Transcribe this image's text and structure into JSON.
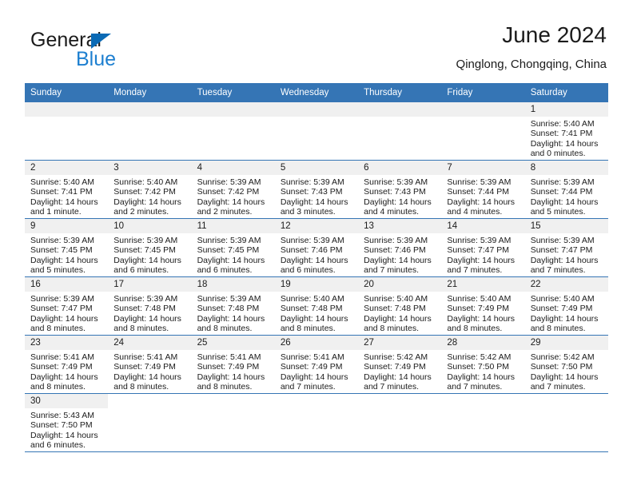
{
  "brand": {
    "name_top": "General",
    "name_bottom": "Blue",
    "accent_color": "#1d7fd0",
    "triangle_color": "#0a6ab5"
  },
  "header": {
    "title": "June 2024",
    "subtitle": "Qinglong, Chongqing, China"
  },
  "calendar": {
    "header_bg": "#3575b5",
    "daynum_bg": "#f0f0f0",
    "weekdays": [
      "Sunday",
      "Monday",
      "Tuesday",
      "Wednesday",
      "Thursday",
      "Friday",
      "Saturday"
    ],
    "weeks": [
      [
        {
          "day": "",
          "sunrise": "",
          "sunset": "",
          "daylight1": "",
          "daylight2": "",
          "empty": true
        },
        {
          "day": "",
          "sunrise": "",
          "sunset": "",
          "daylight1": "",
          "daylight2": "",
          "empty": true
        },
        {
          "day": "",
          "sunrise": "",
          "sunset": "",
          "daylight1": "",
          "daylight2": "",
          "empty": true
        },
        {
          "day": "",
          "sunrise": "",
          "sunset": "",
          "daylight1": "",
          "daylight2": "",
          "empty": true
        },
        {
          "day": "",
          "sunrise": "",
          "sunset": "",
          "daylight1": "",
          "daylight2": "",
          "empty": true
        },
        {
          "day": "",
          "sunrise": "",
          "sunset": "",
          "daylight1": "",
          "daylight2": "",
          "empty": true
        },
        {
          "day": "1",
          "sunrise": "Sunrise: 5:40 AM",
          "sunset": "Sunset: 7:41 PM",
          "daylight1": "Daylight: 14 hours",
          "daylight2": "and 0 minutes."
        }
      ],
      [
        {
          "day": "2",
          "sunrise": "Sunrise: 5:40 AM",
          "sunset": "Sunset: 7:41 PM",
          "daylight1": "Daylight: 14 hours",
          "daylight2": "and 1 minute."
        },
        {
          "day": "3",
          "sunrise": "Sunrise: 5:40 AM",
          "sunset": "Sunset: 7:42 PM",
          "daylight1": "Daylight: 14 hours",
          "daylight2": "and 2 minutes."
        },
        {
          "day": "4",
          "sunrise": "Sunrise: 5:39 AM",
          "sunset": "Sunset: 7:42 PM",
          "daylight1": "Daylight: 14 hours",
          "daylight2": "and 2 minutes."
        },
        {
          "day": "5",
          "sunrise": "Sunrise: 5:39 AM",
          "sunset": "Sunset: 7:43 PM",
          "daylight1": "Daylight: 14 hours",
          "daylight2": "and 3 minutes."
        },
        {
          "day": "6",
          "sunrise": "Sunrise: 5:39 AM",
          "sunset": "Sunset: 7:43 PM",
          "daylight1": "Daylight: 14 hours",
          "daylight2": "and 4 minutes."
        },
        {
          "day": "7",
          "sunrise": "Sunrise: 5:39 AM",
          "sunset": "Sunset: 7:44 PM",
          "daylight1": "Daylight: 14 hours",
          "daylight2": "and 4 minutes."
        },
        {
          "day": "8",
          "sunrise": "Sunrise: 5:39 AM",
          "sunset": "Sunset: 7:44 PM",
          "daylight1": "Daylight: 14 hours",
          "daylight2": "and 5 minutes."
        }
      ],
      [
        {
          "day": "9",
          "sunrise": "Sunrise: 5:39 AM",
          "sunset": "Sunset: 7:45 PM",
          "daylight1": "Daylight: 14 hours",
          "daylight2": "and 5 minutes."
        },
        {
          "day": "10",
          "sunrise": "Sunrise: 5:39 AM",
          "sunset": "Sunset: 7:45 PM",
          "daylight1": "Daylight: 14 hours",
          "daylight2": "and 6 minutes."
        },
        {
          "day": "11",
          "sunrise": "Sunrise: 5:39 AM",
          "sunset": "Sunset: 7:45 PM",
          "daylight1": "Daylight: 14 hours",
          "daylight2": "and 6 minutes."
        },
        {
          "day": "12",
          "sunrise": "Sunrise: 5:39 AM",
          "sunset": "Sunset: 7:46 PM",
          "daylight1": "Daylight: 14 hours",
          "daylight2": "and 6 minutes."
        },
        {
          "day": "13",
          "sunrise": "Sunrise: 5:39 AM",
          "sunset": "Sunset: 7:46 PM",
          "daylight1": "Daylight: 14 hours",
          "daylight2": "and 7 minutes."
        },
        {
          "day": "14",
          "sunrise": "Sunrise: 5:39 AM",
          "sunset": "Sunset: 7:47 PM",
          "daylight1": "Daylight: 14 hours",
          "daylight2": "and 7 minutes."
        },
        {
          "day": "15",
          "sunrise": "Sunrise: 5:39 AM",
          "sunset": "Sunset: 7:47 PM",
          "daylight1": "Daylight: 14 hours",
          "daylight2": "and 7 minutes."
        }
      ],
      [
        {
          "day": "16",
          "sunrise": "Sunrise: 5:39 AM",
          "sunset": "Sunset: 7:47 PM",
          "daylight1": "Daylight: 14 hours",
          "daylight2": "and 8 minutes."
        },
        {
          "day": "17",
          "sunrise": "Sunrise: 5:39 AM",
          "sunset": "Sunset: 7:48 PM",
          "daylight1": "Daylight: 14 hours",
          "daylight2": "and 8 minutes."
        },
        {
          "day": "18",
          "sunrise": "Sunrise: 5:39 AM",
          "sunset": "Sunset: 7:48 PM",
          "daylight1": "Daylight: 14 hours",
          "daylight2": "and 8 minutes."
        },
        {
          "day": "19",
          "sunrise": "Sunrise: 5:40 AM",
          "sunset": "Sunset: 7:48 PM",
          "daylight1": "Daylight: 14 hours",
          "daylight2": "and 8 minutes."
        },
        {
          "day": "20",
          "sunrise": "Sunrise: 5:40 AM",
          "sunset": "Sunset: 7:48 PM",
          "daylight1": "Daylight: 14 hours",
          "daylight2": "and 8 minutes."
        },
        {
          "day": "21",
          "sunrise": "Sunrise: 5:40 AM",
          "sunset": "Sunset: 7:49 PM",
          "daylight1": "Daylight: 14 hours",
          "daylight2": "and 8 minutes."
        },
        {
          "day": "22",
          "sunrise": "Sunrise: 5:40 AM",
          "sunset": "Sunset: 7:49 PM",
          "daylight1": "Daylight: 14 hours",
          "daylight2": "and 8 minutes."
        }
      ],
      [
        {
          "day": "23",
          "sunrise": "Sunrise: 5:41 AM",
          "sunset": "Sunset: 7:49 PM",
          "daylight1": "Daylight: 14 hours",
          "daylight2": "and 8 minutes."
        },
        {
          "day": "24",
          "sunrise": "Sunrise: 5:41 AM",
          "sunset": "Sunset: 7:49 PM",
          "daylight1": "Daylight: 14 hours",
          "daylight2": "and 8 minutes."
        },
        {
          "day": "25",
          "sunrise": "Sunrise: 5:41 AM",
          "sunset": "Sunset: 7:49 PM",
          "daylight1": "Daylight: 14 hours",
          "daylight2": "and 8 minutes."
        },
        {
          "day": "26",
          "sunrise": "Sunrise: 5:41 AM",
          "sunset": "Sunset: 7:49 PM",
          "daylight1": "Daylight: 14 hours",
          "daylight2": "and 7 minutes."
        },
        {
          "day": "27",
          "sunrise": "Sunrise: 5:42 AM",
          "sunset": "Sunset: 7:49 PM",
          "daylight1": "Daylight: 14 hours",
          "daylight2": "and 7 minutes."
        },
        {
          "day": "28",
          "sunrise": "Sunrise: 5:42 AM",
          "sunset": "Sunset: 7:50 PM",
          "daylight1": "Daylight: 14 hours",
          "daylight2": "and 7 minutes."
        },
        {
          "day": "29",
          "sunrise": "Sunrise: 5:42 AM",
          "sunset": "Sunset: 7:50 PM",
          "daylight1": "Daylight: 14 hours",
          "daylight2": "and 7 minutes."
        }
      ],
      [
        {
          "day": "30",
          "sunrise": "Sunrise: 5:43 AM",
          "sunset": "Sunset: 7:50 PM",
          "daylight1": "Daylight: 14 hours",
          "daylight2": "and 6 minutes."
        },
        {
          "day": "",
          "sunrise": "",
          "sunset": "",
          "daylight1": "",
          "daylight2": "",
          "trailing": true
        },
        {
          "day": "",
          "sunrise": "",
          "sunset": "",
          "daylight1": "",
          "daylight2": "",
          "trailing": true
        },
        {
          "day": "",
          "sunrise": "",
          "sunset": "",
          "daylight1": "",
          "daylight2": "",
          "trailing": true
        },
        {
          "day": "",
          "sunrise": "",
          "sunset": "",
          "daylight1": "",
          "daylight2": "",
          "trailing": true
        },
        {
          "day": "",
          "sunrise": "",
          "sunset": "",
          "daylight1": "",
          "daylight2": "",
          "trailing": true
        },
        {
          "day": "",
          "sunrise": "",
          "sunset": "",
          "daylight1": "",
          "daylight2": "",
          "trailing": true
        }
      ]
    ]
  }
}
